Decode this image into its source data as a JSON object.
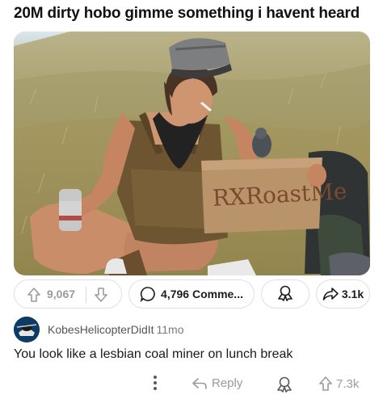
{
  "post": {
    "title": "20M dirty hobo gimme something i havent heard",
    "image": {
      "sign_text": "RXRoastMe"
    }
  },
  "actions": {
    "score": "9,067",
    "comments_label": "4,796 Comme...",
    "share_count": "3.1k"
  },
  "comment": {
    "author": "KobesHelicopterDidIt",
    "time": "11mo",
    "body": "You look like a lesbian coal miner on lunch break",
    "reply_label": "Reply",
    "score": "7.3k"
  },
  "colors": {
    "muted": "#9a9a9a",
    "border": "#e0e0e0",
    "avatar_bg": "#0d3b63"
  },
  "icons": [
    "upvote-icon",
    "downvote-icon",
    "comment-bubble-icon",
    "award-icon",
    "share-arrow-icon",
    "more-vertical-icon",
    "reply-icon"
  ]
}
